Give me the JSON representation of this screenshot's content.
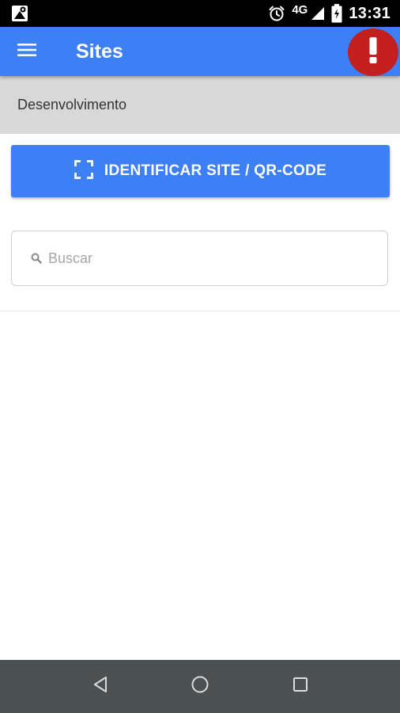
{
  "status_bar": {
    "network": "4G",
    "time": "13:31",
    "icons": [
      "maps-notification-icon",
      "alarm-icon",
      "signal-icon",
      "battery-charging-icon"
    ]
  },
  "app_bar": {
    "title": "Sites",
    "menu_icon": "hamburger-menu-icon",
    "alert_icon": "exclamation-icon"
  },
  "environment": {
    "label": "Desenvolvimento"
  },
  "qr_button": {
    "label": "IDENTIFICAR SITE / QR-CODE",
    "icon": "scan-frame-icon"
  },
  "search": {
    "value": "",
    "placeholder": "Buscar",
    "icon": "search-icon"
  },
  "nav_bar": {
    "icons": [
      "back-icon",
      "home-icon",
      "recents-icon"
    ]
  },
  "colors": {
    "primary": "#3d7ff5",
    "alert": "#c41f1f",
    "env_bar": "#d8d8d8",
    "nav_bar": "#4b5151",
    "status_bar": "#000000"
  }
}
